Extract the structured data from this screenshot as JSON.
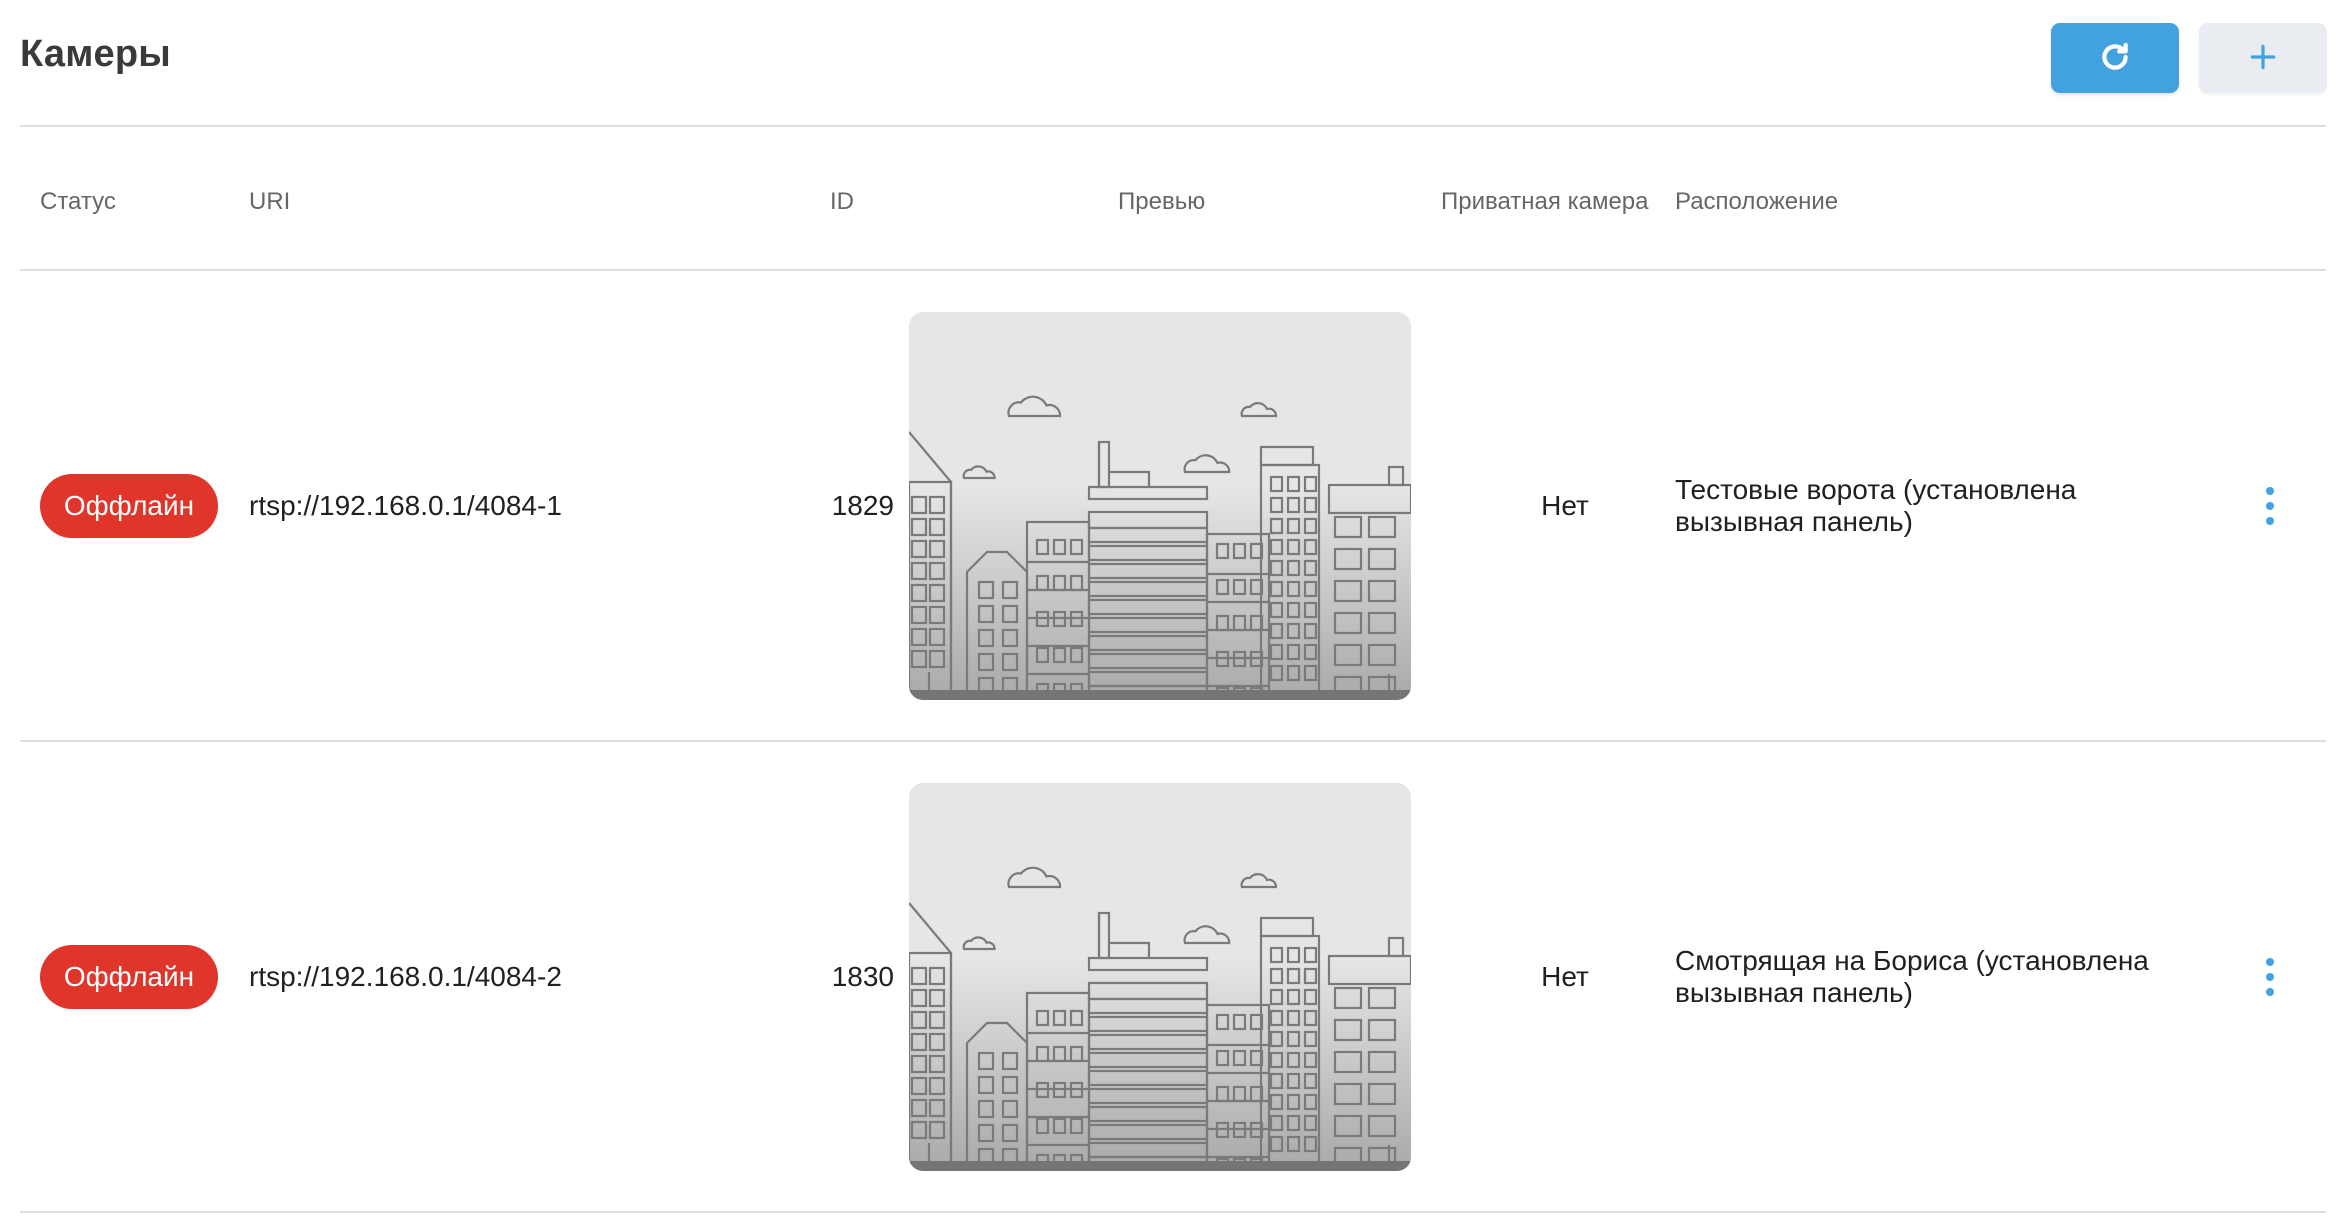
{
  "header": {
    "title": "Камеры",
    "refresh_icon": "refresh-icon",
    "add_icon": "plus-icon"
  },
  "table": {
    "columns": {
      "status": "Статус",
      "uri": "URI",
      "id": "ID",
      "preview": "Превью",
      "private": "Приватная камера",
      "location": "Расположение"
    },
    "rows": [
      {
        "status": "Оффлайн",
        "uri": "rtsp://192.168.0.1/4084-1",
        "id": "1829",
        "preview_icon": "city-placeholder-image",
        "private": "Нет",
        "location": "Тестовые ворота (установлена вызывная панель)",
        "menu_icon": "more-vertical-icon"
      },
      {
        "status": "Оффлайн",
        "uri": "rtsp://192.168.0.1/4084-2",
        "id": "1830",
        "preview_icon": "city-placeholder-image",
        "private": "Нет",
        "location": "Смотрящая на Бориса (установлена вызывная панель)",
        "menu_icon": "more-vertical-icon"
      }
    ]
  },
  "colors": {
    "accent": "#42a2e0",
    "offline": "#e0352b",
    "secondary_button": "#e9ecf0",
    "divider": "#dedede"
  }
}
